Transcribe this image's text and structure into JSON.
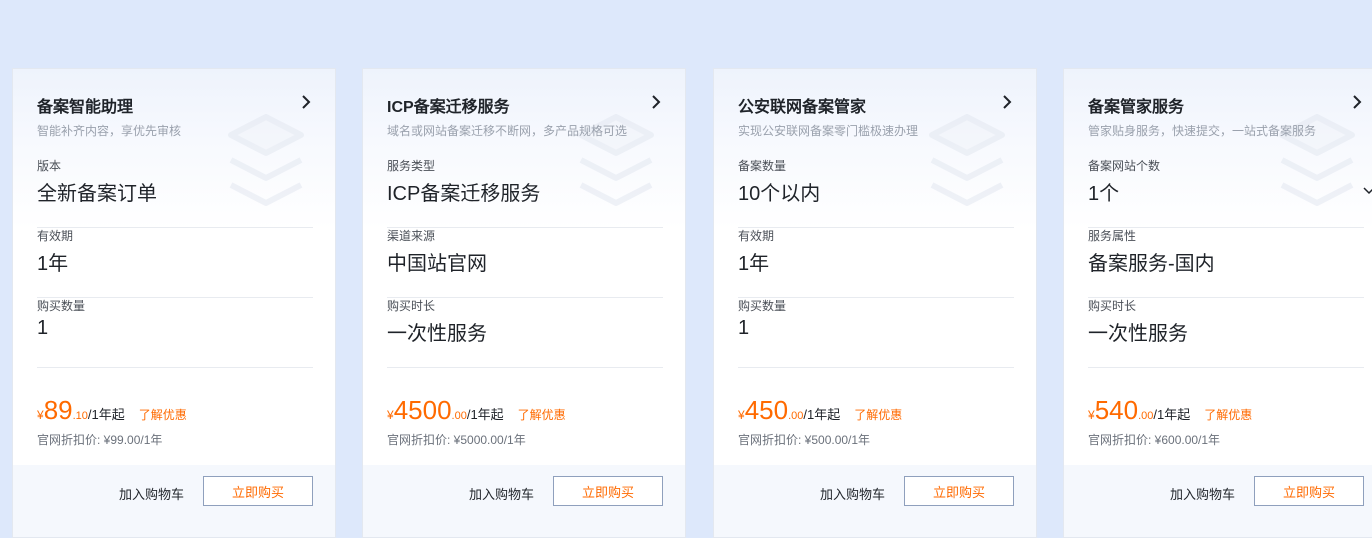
{
  "cards": [
    {
      "title": "备案智能助理",
      "subtitle": "智能补齐内容，享优先审核",
      "fields": [
        {
          "label": "版本",
          "value": "全新备案订单"
        },
        {
          "label": "有效期",
          "value": "1年"
        },
        {
          "label": "购买数量",
          "value": "1"
        }
      ],
      "price": {
        "currency": "¥",
        "integer": "89",
        "decimal": ".10",
        "unit": "/1年起",
        "promo": "了解优惠"
      },
      "original_price": "官网折扣价: ¥99.00/1年",
      "add_cart": "加入购物车",
      "buy_now": "立即购买"
    },
    {
      "title": "ICP备案迁移服务",
      "subtitle": "域名或网站备案迁移不断网，多产品规格可选",
      "fields": [
        {
          "label": "服务类型",
          "value": "ICP备案迁移服务"
        },
        {
          "label": "渠道来源",
          "value": "中国站官网"
        },
        {
          "label": "购买时长",
          "value": "一次性服务"
        }
      ],
      "price": {
        "currency": "¥",
        "integer": "4500",
        "decimal": ".00",
        "unit": "/1年起",
        "promo": "了解优惠"
      },
      "original_price": "官网折扣价: ¥5000.00/1年",
      "add_cart": "加入购物车",
      "buy_now": "立即购买"
    },
    {
      "title": "公安联网备案管家",
      "subtitle": "实现公安联网备案零门槛极速办理",
      "fields": [
        {
          "label": "备案数量",
          "value": "10个以内"
        },
        {
          "label": "有效期",
          "value": "1年"
        },
        {
          "label": "购买数量",
          "value": "1"
        }
      ],
      "price": {
        "currency": "¥",
        "integer": "450",
        "decimal": ".00",
        "unit": "/1年起",
        "promo": "了解优惠"
      },
      "original_price": "官网折扣价: ¥500.00/1年",
      "add_cart": "加入购物车",
      "buy_now": "立即购买"
    },
    {
      "title": "备案管家服务",
      "subtitle": "管家贴身服务，快速提交，一站式备案服务",
      "fields": [
        {
          "label": "备案网站个数",
          "value": "1个"
        },
        {
          "label": "服务属性",
          "value": "备案服务-国内"
        },
        {
          "label": "购买时长",
          "value": "一次性服务"
        }
      ],
      "price": {
        "currency": "¥",
        "integer": "540",
        "decimal": ".00",
        "unit": "/1年起",
        "promo": "了解优惠"
      },
      "original_price": "官网折扣价: ¥600.00/1年",
      "add_cart": "加入购物车",
      "buy_now": "立即购买"
    }
  ],
  "colors": {
    "page_background": "#dde8fb",
    "price_accent": "#ff6a00",
    "button_border": "#8fa0bd",
    "text_primary": "#1f2329",
    "text_secondary": "#9aa1ad"
  },
  "icons": {
    "header_arrow": "chevron-right-icon",
    "dropdown": "chevron-down-icon",
    "decoration": "stacked-layers-illustration"
  }
}
